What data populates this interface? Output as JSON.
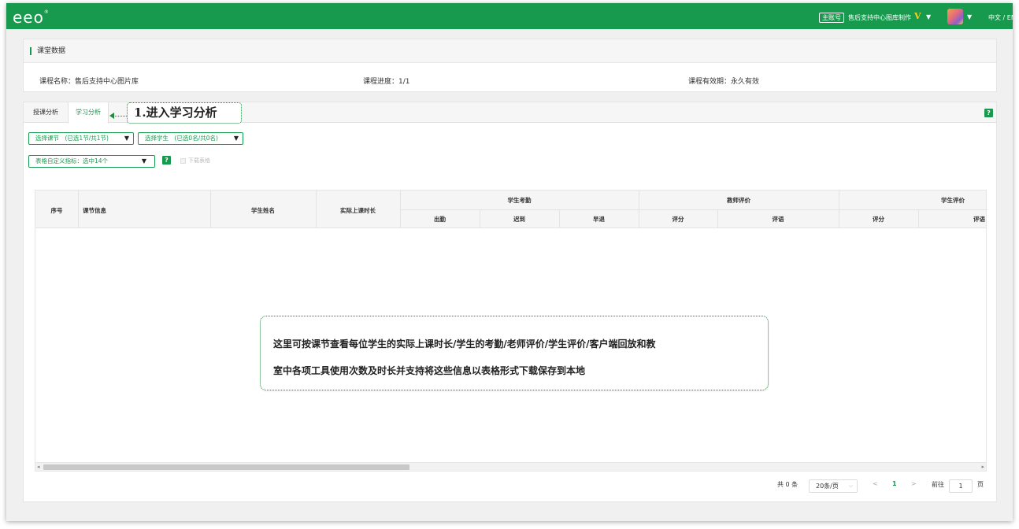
{
  "topbar": {
    "logo": "eeo",
    "logo_mark": "®",
    "account_badge": "主账号",
    "account_name": "售后支持中心图库制作",
    "v_badge": "V",
    "lang": "中文 / EN"
  },
  "course_panel": {
    "title": "课堂数据",
    "course_name": "课程名称：售后支持中心图片库",
    "progress": "课程进度：1/1",
    "validity": "课程有效期：永久有效"
  },
  "tabs": [
    {
      "label": "授课分析"
    },
    {
      "label": "学习分析"
    }
  ],
  "callout_tab": "1.进入学习分析",
  "filters": {
    "lesson_select": "选择课节　(已选1节/共1节)",
    "student_select": "选择学生　(已选0名/共0名)",
    "columns_select": "表格自定义指标：选中14个",
    "download_label": "下载表格"
  },
  "table": {
    "headers": {
      "index": "序号",
      "lesson_info": "课节信息",
      "student_name": "学生姓名",
      "actual_duration": "实际上课时长",
      "attendance": "学生考勤",
      "present": "出勤",
      "late": "迟到",
      "leave_early": "早退",
      "teacher_eval": "教师评价",
      "score1": "评分",
      "comment1": "评语",
      "student_eval": "学生评价",
      "score2": "评分",
      "comment2": "评语"
    }
  },
  "callout_main": {
    "line1": "这里可按课节查看每位学生的实际上课时长/学生的考勤/老师评价/学生评价/客户端回放和教",
    "line2": "室中各项工具使用次数及时长并支持将这些信息以表格形式下载保存到本地"
  },
  "pagination": {
    "total": "共 0 条",
    "page_size": "20条/页",
    "prev": "<",
    "current": "1",
    "next": ">",
    "goto_label": "前往",
    "goto_value": "1",
    "page_unit": "页"
  },
  "icons": {
    "help": "?"
  },
  "colors": {
    "brand_green": "#179a4e",
    "callout_border": "#1f8a3a"
  }
}
